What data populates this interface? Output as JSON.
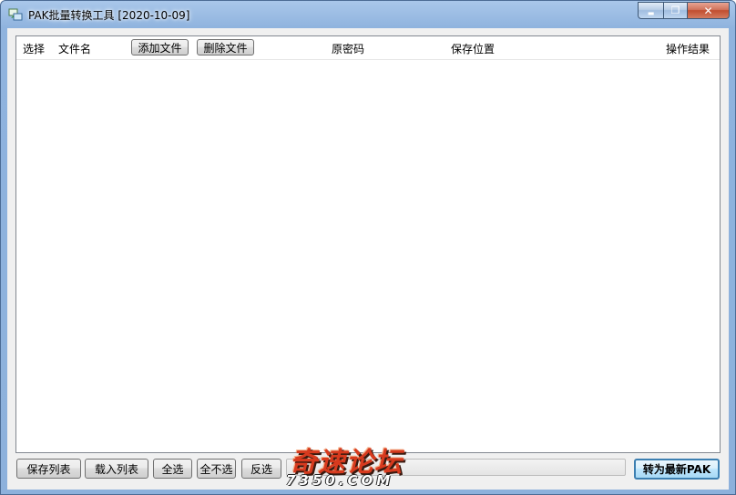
{
  "window": {
    "title": "PAK批量转换工具 [2020-10-09]",
    "controls": {
      "minimize": "▬",
      "maximize": "❐",
      "close": "✕"
    }
  },
  "list": {
    "columns": {
      "select": "选择",
      "filename": "文件名",
      "original_password": "原密码",
      "save_location": "保存位置",
      "result": "操作结果"
    },
    "add_file": "添加文件",
    "delete_file": "删除文件",
    "rows": []
  },
  "footer": {
    "save_list": "保存列表",
    "load_list": "载入列表",
    "select_all": "全选",
    "select_none": "全不选",
    "invert": "反选",
    "progress": 0.0,
    "convert": "转为最新PAK"
  },
  "watermark": {
    "main": "奇速论坛",
    "sub": "7350.COM"
  },
  "colors": {
    "accent": "#3c7fb1",
    "titlebar": "#a9c7ea",
    "close": "#c14d2f",
    "watermark": "#d73a1e"
  },
  "icons": [
    "app-icon",
    "minimize-icon",
    "maximize-icon",
    "close-icon"
  ]
}
